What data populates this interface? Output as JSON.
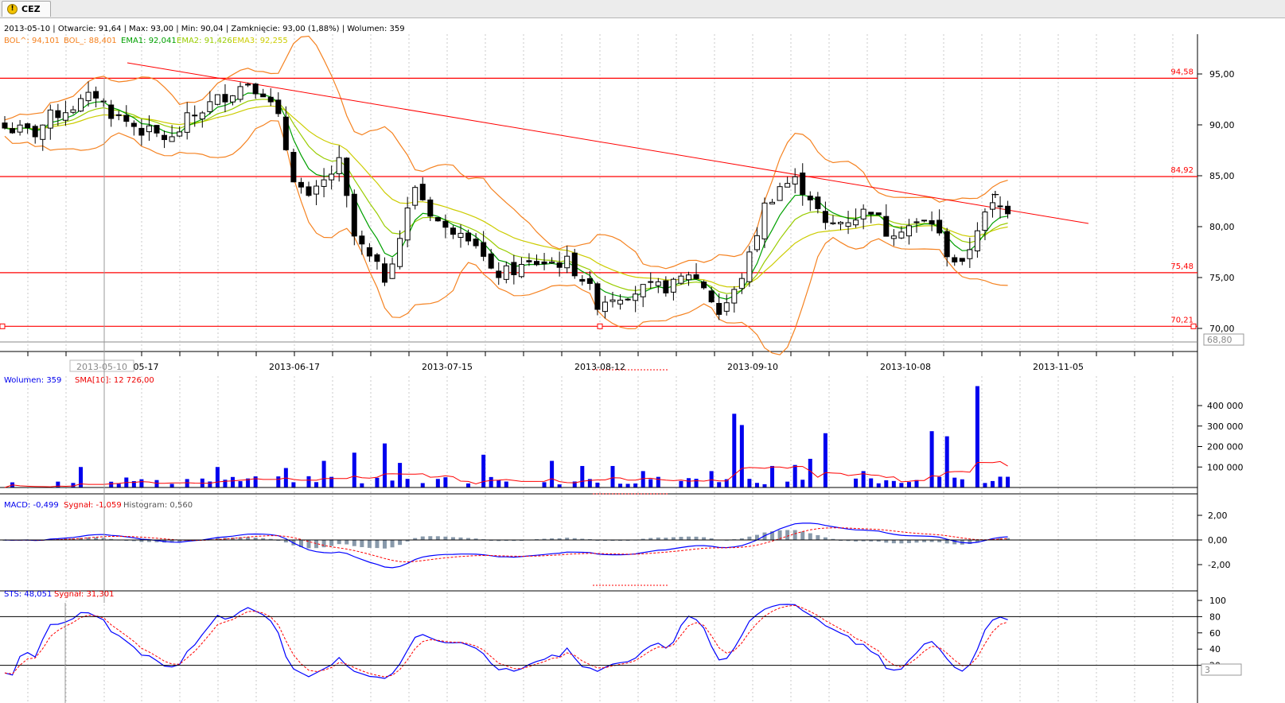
{
  "tab": {
    "label": "CEZ",
    "icon": "warning-icon"
  },
  "header": {
    "ohlc": "2013-05-10 | Otwarcie: 91,64 | Max: 93,00 | Min: 90,04 | Zamknięcie: 93,00 (1,88%) | Wolumen: 359",
    "ind": [
      {
        "label": "BOL^: 94,101",
        "color": "#f58220"
      },
      {
        "label": "BOL_: 88,401",
        "color": "#f58220"
      },
      {
        "label": "EMA1: 92,041",
        "color": "#00a000"
      },
      {
        "label": "EMA2: 91,426",
        "color": "#99cc00"
      },
      {
        "label": "EMA3: 92,255",
        "color": "#cccc00"
      }
    ]
  },
  "price_axis": {
    "ticks": [
      "95,00",
      "90,00",
      "85,00",
      "80,00",
      "75,00",
      "70,00"
    ],
    "current": "68,80"
  },
  "levels": [
    {
      "label": "94,58",
      "value": 94.58
    },
    {
      "label": "84,92",
      "value": 84.92
    },
    {
      "label": "75,48",
      "value": 75.48
    },
    {
      "label": "70,21",
      "value": 70.21
    }
  ],
  "date_axis": {
    "ticks": [
      "2013-06-17",
      "2013-07-15",
      "2013-08-12",
      "2013-09-10",
      "2013-10-08",
      "2013-11-05"
    ],
    "partial": "3-05-17",
    "cursor": "2013-05-10"
  },
  "volume_panel": {
    "label": "Wolumen: 359",
    "sma_label": "SMA[10]: 12 726,00",
    "ticks": [
      "400 000",
      "300 000",
      "200 000",
      "100 000"
    ]
  },
  "macd_panel": {
    "macd_label": "MACD: -0,499",
    "signal_label": "Sygnał: -1,059",
    "hist_label": "Histogram: 0,560",
    "ticks": [
      "2,00",
      "0,00",
      "-2,00"
    ]
  },
  "sts_panel": {
    "sts_label": "STS: 48,051",
    "signal_label": "Sygnał: 31,301",
    "ticks": [
      "100",
      "80",
      "60",
      "40",
      "20"
    ],
    "current": "3"
  },
  "colors": {
    "candle_up": "#ffffff",
    "candle_down": "#000000",
    "level": "#ff0000",
    "bollinger": "#f58220",
    "ema1": "#00a000",
    "ema2": "#99cc00",
    "ema3": "#cccc00",
    "volume": "#0000ee",
    "sma": "#ff0000",
    "macd": "#0000ff",
    "signal": "#ff0000",
    "histogram": "#8899aa"
  },
  "chart_data": {
    "type": "candlestick",
    "anchors_close": [
      [
        0,
        89.7
      ],
      [
        4,
        89.2
      ],
      [
        6,
        90.8
      ],
      [
        10,
        92.2
      ],
      [
        12,
        93
      ],
      [
        14,
        91.2
      ],
      [
        18,
        89.5
      ],
      [
        22,
        88.5
      ],
      [
        24,
        90.5
      ],
      [
        28,
        92.5
      ],
      [
        32,
        94.2
      ],
      [
        34,
        93.3
      ],
      [
        36,
        90.5
      ],
      [
        38,
        85
      ],
      [
        40,
        82.5
      ],
      [
        44,
        86.2
      ],
      [
        46,
        79
      ],
      [
        48,
        76.8
      ],
      [
        50,
        75
      ],
      [
        52,
        79
      ],
      [
        54,
        84
      ],
      [
        56,
        81.5
      ],
      [
        58,
        79.6
      ],
      [
        60,
        80
      ],
      [
        62,
        78.5
      ],
      [
        64,
        75.3
      ],
      [
        66,
        75.5
      ],
      [
        68,
        76
      ],
      [
        70,
        76.5
      ],
      [
        74,
        76.5
      ],
      [
        76,
        75
      ],
      [
        78,
        72.5
      ],
      [
        80,
        73.2
      ],
      [
        84,
        73.8
      ],
      [
        88,
        74.2
      ],
      [
        90,
        75.5
      ],
      [
        92,
        74.2
      ],
      [
        94,
        71.5
      ],
      [
        96,
        73.5
      ],
      [
        98,
        77
      ],
      [
        100,
        82
      ],
      [
        102,
        84
      ],
      [
        104,
        84.5
      ],
      [
        106,
        83
      ],
      [
        108,
        80
      ],
      [
        110,
        80.5
      ],
      [
        112,
        81
      ],
      [
        114,
        81.8
      ],
      [
        116,
        79.5
      ],
      [
        118,
        80
      ],
      [
        120,
        80.2
      ],
      [
        122,
        80.5
      ],
      [
        124,
        77.5
      ],
      [
        126,
        76
      ],
      [
        128,
        80
      ],
      [
        130,
        82
      ],
      [
        132,
        81.8
      ]
    ],
    "volume_max": 400000,
    "macd_range": [
      -3.5,
      3
    ],
    "sts_range": [
      0,
      100
    ],
    "ylim": [
      68.8,
      96.5
    ]
  }
}
